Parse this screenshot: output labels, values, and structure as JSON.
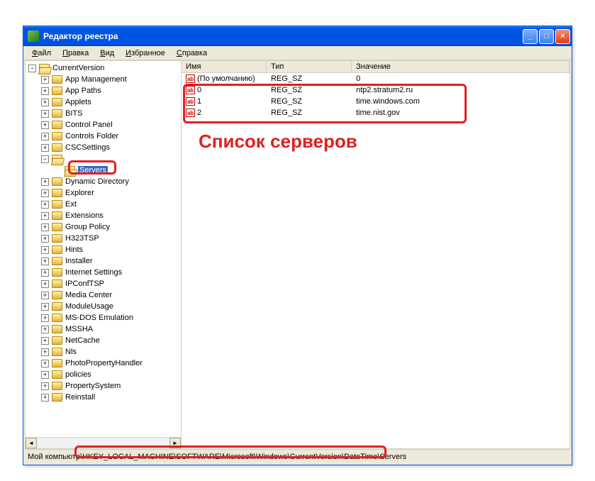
{
  "window": {
    "title": "Редактор реестра"
  },
  "menu": {
    "file": "Файл",
    "edit": "Правка",
    "view": "Вид",
    "favorites": "Избранное",
    "help": "Справка"
  },
  "tree": {
    "root": "CurrentVersion",
    "items": [
      "App Management",
      "App Paths",
      "Applets",
      "BITS",
      "Control Panel",
      "Controls Folder",
      "CSCSettings"
    ],
    "dateTimeNode": "",
    "selected": "Servers",
    "items2": [
      "Dynamic Directory",
      "Explorer",
      "Ext",
      "Extensions",
      "Group Policy",
      "H323TSP",
      "Hints",
      "Installer",
      "Internet Settings",
      "IPConfTSP",
      "Media Center",
      "ModuleUsage",
      "MS-DOS Emulation",
      "MSSHA",
      "NetCache",
      "Nls",
      "PhotoPropertyHandler",
      "policies",
      "PropertySystem",
      "Reinstall"
    ]
  },
  "list": {
    "headers": {
      "name": "Имя",
      "type": "Тип",
      "value": "Значение"
    },
    "default": {
      "name": "(По умолчанию)",
      "type": "REG_SZ",
      "value": "0"
    },
    "rows": [
      {
        "name": "0",
        "type": "REG_SZ",
        "value": "ntp2.stratum2.ru"
      },
      {
        "name": "1",
        "type": "REG_SZ",
        "value": "time.windows.com"
      },
      {
        "name": "2",
        "type": "REG_SZ",
        "value": "time.nist.gov"
      }
    ]
  },
  "statusbar": {
    "prefix": "Мой компьют",
    "path": "р\\HKEY_LOCAL_MACHINE\\SOFTWARE\\Microsoft\\Windows\\CurrentVersion\\DateTime\\Servers"
  },
  "annotation": {
    "text": "Список серверов"
  }
}
